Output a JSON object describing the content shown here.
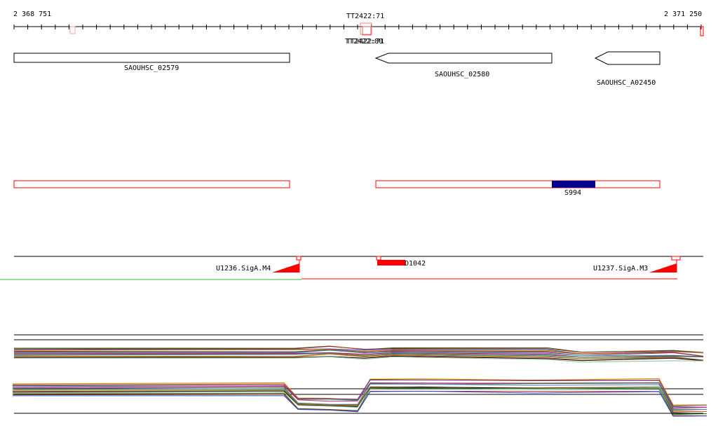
{
  "ruler": {
    "start_label": "2 368 751",
    "end_label": "2 371 250",
    "terminator_top": "TT2422:71",
    "terminator_overlap": "TT2422:80"
  },
  "genes": [
    {
      "id": "gene-saouhsc-02579",
      "label": "SAOUHSC_02579",
      "strand": "+"
    },
    {
      "id": "gene-saouhsc-02580",
      "label": "SAOUHSC_02580",
      "strand": "-"
    },
    {
      "id": "gene-saouhsc-a02450",
      "label": "SAOUHSC_A02450",
      "strand": "-"
    }
  ],
  "features": {
    "s994_label": "S994",
    "s994_color": "#00008b",
    "d1042_label": "D1042",
    "promoter_m4_label": "U1236.SigA.M4",
    "promoter_m3_label": "U1237.SigA.M3"
  },
  "colors": {
    "outline_red": "#ff0000",
    "green_line": "#2db82d",
    "gene_outline": "#000000"
  },
  "expression_palette": [
    "#1f7a1f",
    "#b22222",
    "#2e4fd6",
    "#d98c00",
    "#8b4513",
    "#7a2e8b",
    "#3aa0a0",
    "#c71585",
    "#556b2f",
    "#4682b4",
    "#808000",
    "#e06040",
    "#000000",
    "#8fbc8f"
  ]
}
